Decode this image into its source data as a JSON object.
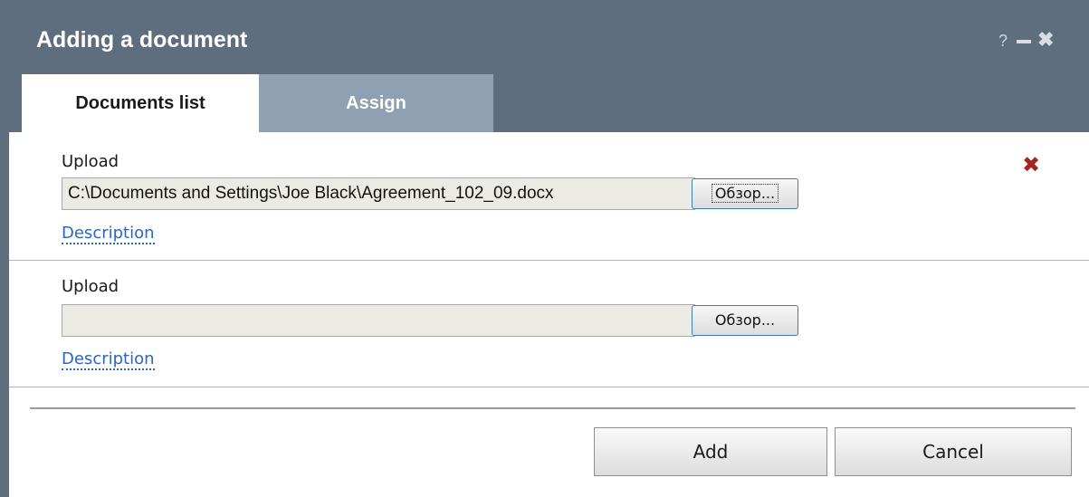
{
  "window": {
    "title": "Adding a document",
    "help_glyph": "?",
    "close_glyph": "✖"
  },
  "tabs": [
    {
      "label": "Documents list",
      "active": true
    },
    {
      "label": "Assign",
      "active": false
    }
  ],
  "uploads": [
    {
      "label": "Upload",
      "file_path": "C:\\Documents and Settings\\Joe Black\\Agreement_102_09.docx",
      "browse_label": "Обзор...",
      "description_link": "Description",
      "remove_icon": "remove-x-icon"
    },
    {
      "label": "Upload",
      "file_path": "",
      "browse_label": "Обзор...",
      "description_link": "Description"
    }
  ],
  "remove_glyph": "✖",
  "actions": {
    "add_label": "Add",
    "cancel_label": "Cancel"
  },
  "colors": {
    "titlebar": "#5f6e7e",
    "inactive_tab": "#8ea0b2",
    "link": "#2a66c4",
    "remove_icon": "#a3281c"
  }
}
